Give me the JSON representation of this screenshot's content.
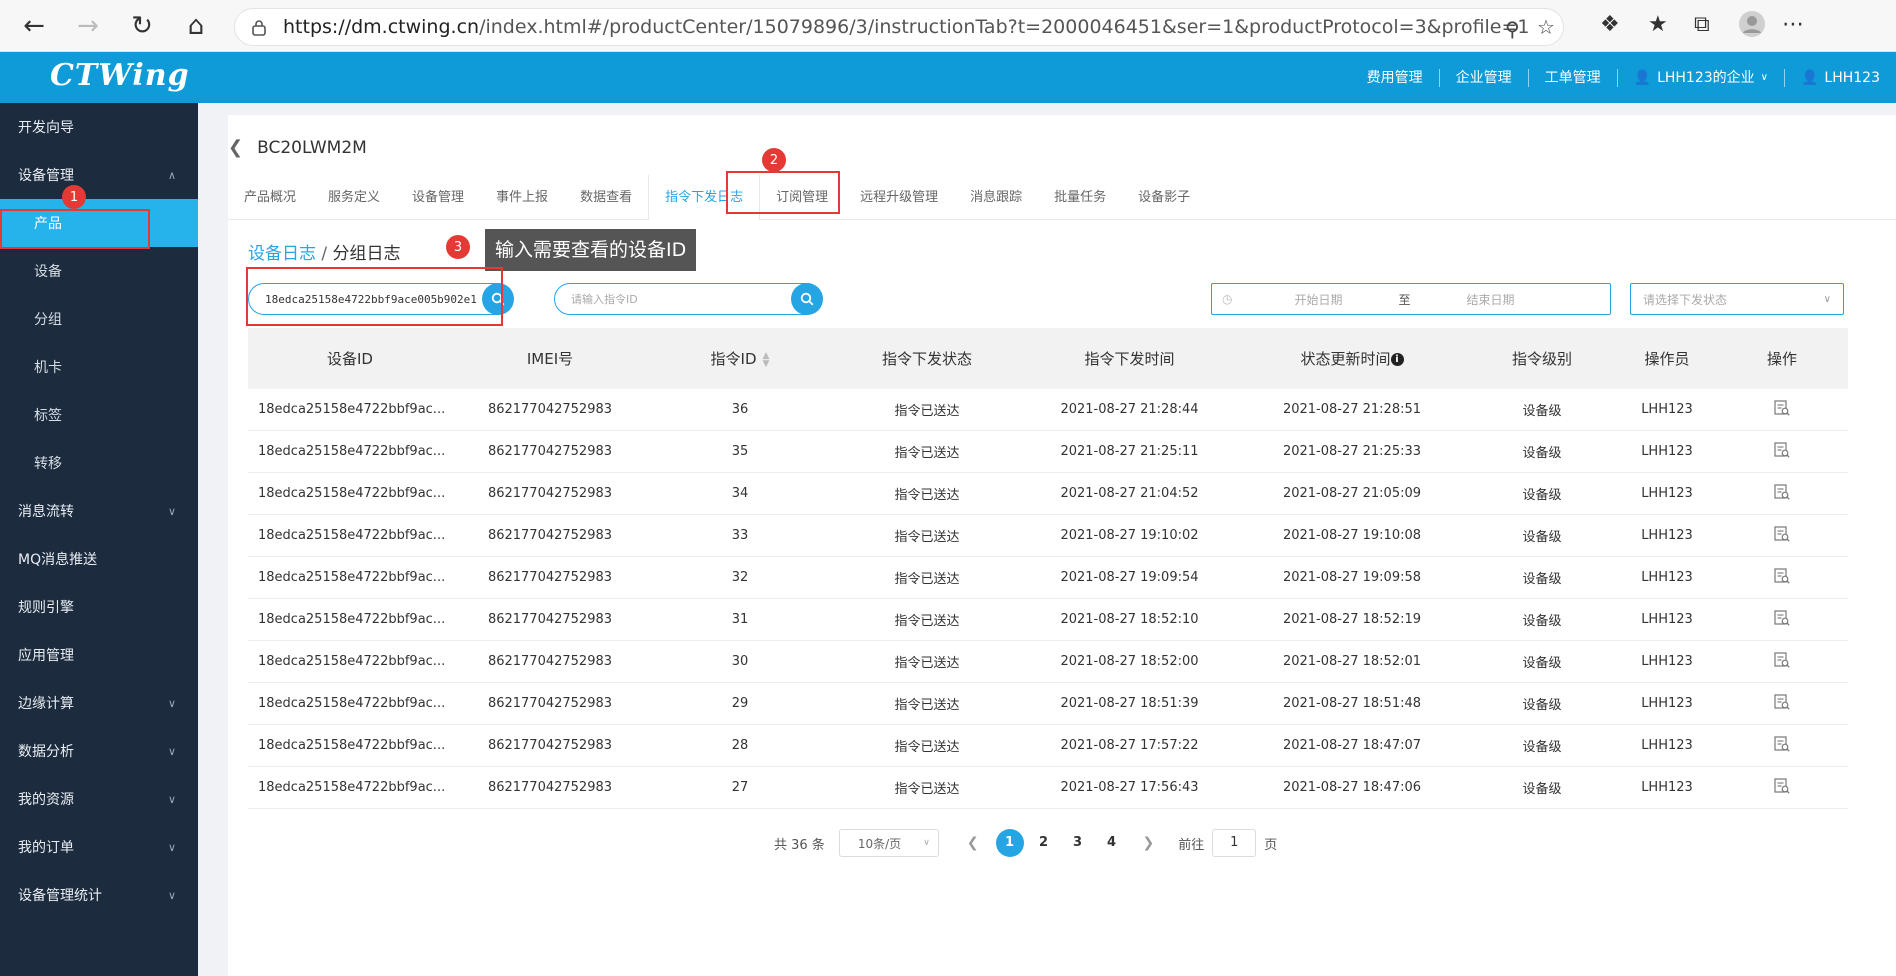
{
  "browser": {
    "url_prefix": "https://dm.ctwing.cn",
    "url_rest": "/index.html#/productCenter/15079896/3/instructionTab?t=2000046451&ser=1&productProtocol=3&profile=1"
  },
  "header": {
    "logo_text": "CTWing",
    "links": [
      "费用管理",
      "企业管理",
      "工单管理"
    ],
    "company": "LHH123的企业",
    "user": "LHH123"
  },
  "sidebar": {
    "items": [
      {
        "label": "开发向导"
      },
      {
        "label": "设备管理"
      },
      {
        "label": "产品"
      },
      {
        "label": "设备"
      },
      {
        "label": "分组"
      },
      {
        "label": "机卡"
      },
      {
        "label": "标签"
      },
      {
        "label": "转移"
      },
      {
        "label": "消息流转"
      },
      {
        "label": "MQ消息推送"
      },
      {
        "label": "规则引擎"
      },
      {
        "label": "应用管理"
      },
      {
        "label": "边缘计算"
      },
      {
        "label": "数据分析"
      },
      {
        "label": "我的资源"
      },
      {
        "label": "我的订单"
      },
      {
        "label": "设备管理统计"
      }
    ]
  },
  "page": {
    "title": "BC20LWM2M",
    "tabs": [
      "产品概况",
      "服务定义",
      "设备管理",
      "事件上报",
      "数据查看",
      "指令下发日志",
      "订阅管理",
      "远程升级管理",
      "消息跟踪",
      "批量任务",
      "设备影子"
    ],
    "subtab_active": "设备日志",
    "subtab_sep": "/",
    "subtab_inactive": "分组日志",
    "tooltip": "输入需要查看的设备ID",
    "annotations": [
      "1",
      "2",
      "3"
    ]
  },
  "filters": {
    "device_id_value": "18edca25158e4722bbf9ace005b902e1",
    "cmd_id_placeholder": "请输入指令ID",
    "start_date_placeholder": "开始日期",
    "date_sep": "至",
    "end_date_placeholder": "结束日期",
    "status_placeholder": "请选择下发状态"
  },
  "table": {
    "headers": [
      "设备ID",
      "IMEI号",
      "指令ID",
      "指令下发状态",
      "指令下发时间",
      "状态更新时间",
      "指令级别",
      "操作员",
      "操作"
    ],
    "rows": [
      [
        "18edca25158e4722bbf9ac...",
        "862177042752983",
        "36",
        "指令已送达",
        "2021-08-27 21:28:44",
        "2021-08-27 21:28:51",
        "设备级",
        "LHH123"
      ],
      [
        "18edca25158e4722bbf9ac...",
        "862177042752983",
        "35",
        "指令已送达",
        "2021-08-27 21:25:11",
        "2021-08-27 21:25:33",
        "设备级",
        "LHH123"
      ],
      [
        "18edca25158e4722bbf9ac...",
        "862177042752983",
        "34",
        "指令已送达",
        "2021-08-27 21:04:52",
        "2021-08-27 21:05:09",
        "设备级",
        "LHH123"
      ],
      [
        "18edca25158e4722bbf9ac...",
        "862177042752983",
        "33",
        "指令已送达",
        "2021-08-27 19:10:02",
        "2021-08-27 19:10:08",
        "设备级",
        "LHH123"
      ],
      [
        "18edca25158e4722bbf9ac...",
        "862177042752983",
        "32",
        "指令已送达",
        "2021-08-27 19:09:54",
        "2021-08-27 19:09:58",
        "设备级",
        "LHH123"
      ],
      [
        "18edca25158e4722bbf9ac...",
        "862177042752983",
        "31",
        "指令已送达",
        "2021-08-27 18:52:10",
        "2021-08-27 18:52:19",
        "设备级",
        "LHH123"
      ],
      [
        "18edca25158e4722bbf9ac...",
        "862177042752983",
        "30",
        "指令已送达",
        "2021-08-27 18:52:00",
        "2021-08-27 18:52:01",
        "设备级",
        "LHH123"
      ],
      [
        "18edca25158e4722bbf9ac...",
        "862177042752983",
        "29",
        "指令已送达",
        "2021-08-27 18:51:39",
        "2021-08-27 18:51:48",
        "设备级",
        "LHH123"
      ],
      [
        "18edca25158e4722bbf9ac...",
        "862177042752983",
        "28",
        "指令已送达",
        "2021-08-27 17:57:22",
        "2021-08-27 18:47:07",
        "设备级",
        "LHH123"
      ],
      [
        "18edca25158e4722bbf9ac...",
        "862177042752983",
        "27",
        "指令已送达",
        "2021-08-27 17:56:43",
        "2021-08-27 18:47:06",
        "设备级",
        "LHH123"
      ]
    ]
  },
  "pagination": {
    "total": "共 36 条",
    "page_size": "10条/页",
    "pages": [
      "1",
      "2",
      "3",
      "4"
    ],
    "goto_label": "前往",
    "goto_value": "1",
    "page_suffix": "页"
  },
  "colors": {
    "header_bg": "#0f9bd7",
    "sidebar_bg": "#1c2b3d",
    "accent": "#26a5e5",
    "annotation": "#e53935"
  }
}
